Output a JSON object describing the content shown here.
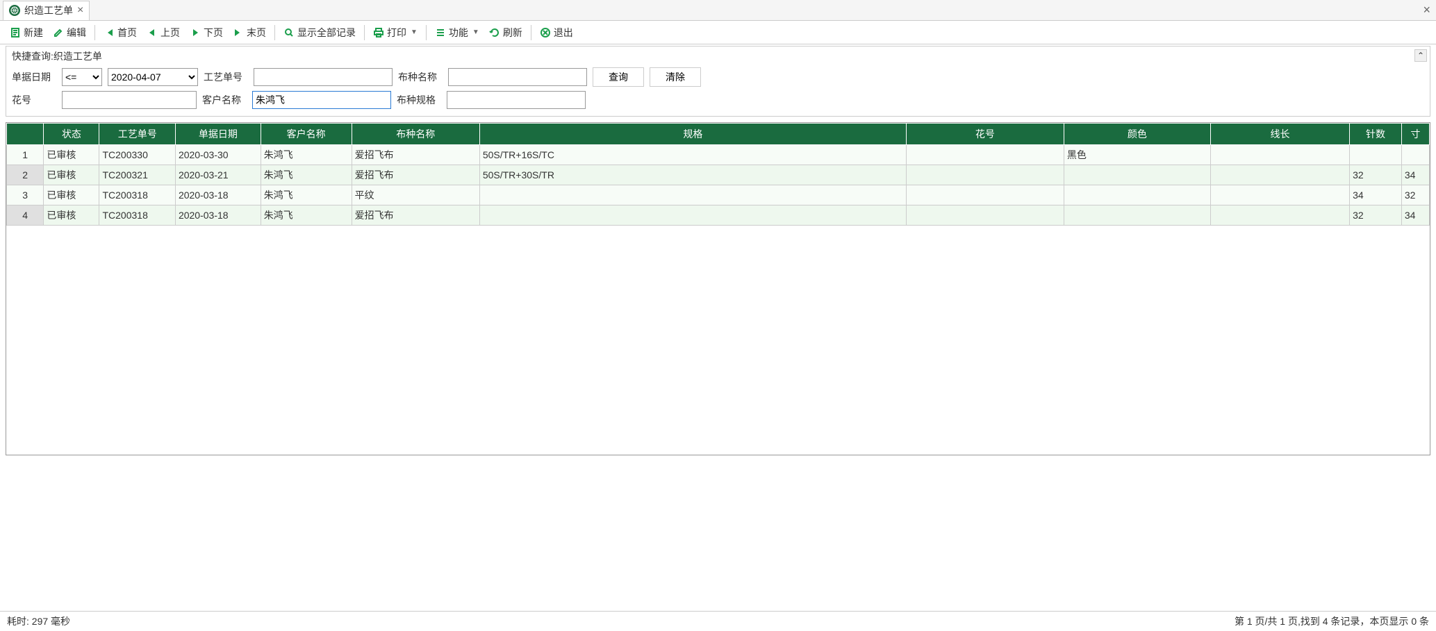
{
  "tab": {
    "title": "织造工艺单"
  },
  "toolbar": {
    "new": "新建",
    "edit": "编辑",
    "first": "首页",
    "prev": "上页",
    "next": "下页",
    "last": "末页",
    "showall": "显示全部记录",
    "print": "打印",
    "func": "功能",
    "refresh": "刷新",
    "exit": "退出"
  },
  "query": {
    "title": "快捷查询:织造工艺单",
    "labels": {
      "date": "单据日期",
      "orderNo": "工艺单号",
      "fabricName": "布种名称",
      "flowerNo": "花号",
      "customer": "客户名称",
      "fabricSpec": "布种规格"
    },
    "operator": "<=",
    "date": "2020-04-07",
    "orderNo": "",
    "fabricName": "",
    "flowerNo": "",
    "customer": "朱鸿飞",
    "fabricSpec": "",
    "searchBtn": "查询",
    "clearBtn": "清除"
  },
  "grid": {
    "headers": {
      "status": "状态",
      "orderNo": "工艺单号",
      "date": "单据日期",
      "customer": "客户名称",
      "fabricName": "布种名称",
      "spec": "规格",
      "flowerNo": "花号",
      "color": "颜色",
      "lineLen": "线长",
      "needle": "针数",
      "inch": "寸"
    },
    "rows": [
      {
        "n": "1",
        "status": "已审核",
        "orderNo": "TC200330",
        "date": "2020-03-30",
        "customer": "朱鸿飞",
        "fabricName": "爱招飞布",
        "spec": "50S/TR+16S/TC",
        "flowerNo": "",
        "color": "黑色",
        "lineLen": "",
        "needle": "",
        "inch": ""
      },
      {
        "n": "2",
        "status": "已审核",
        "orderNo": "TC200321",
        "date": "2020-03-21",
        "customer": "朱鸿飞",
        "fabricName": "爱招飞布",
        "spec": "50S/TR+30S/TR",
        "flowerNo": "",
        "color": "",
        "lineLen": "",
        "needle": "32",
        "inch": "34"
      },
      {
        "n": "3",
        "status": "已审核",
        "orderNo": "TC200318",
        "date": "2020-03-18",
        "customer": "朱鸿飞",
        "fabricName": "平纹",
        "spec": "",
        "flowerNo": "",
        "color": "",
        "lineLen": "",
        "needle": "34",
        "inch": "32"
      },
      {
        "n": "4",
        "status": "已审核",
        "orderNo": "TC200318",
        "date": "2020-03-18",
        "customer": "朱鸿飞",
        "fabricName": "爱招飞布",
        "spec": "",
        "flowerNo": "",
        "color": "",
        "lineLen": "",
        "needle": "32",
        "inch": "34"
      }
    ]
  },
  "status": {
    "left": "耗时: 297 毫秒",
    "right": "第 1 页/共 1 页,找到 4 条记录，本页显示 0 条"
  }
}
